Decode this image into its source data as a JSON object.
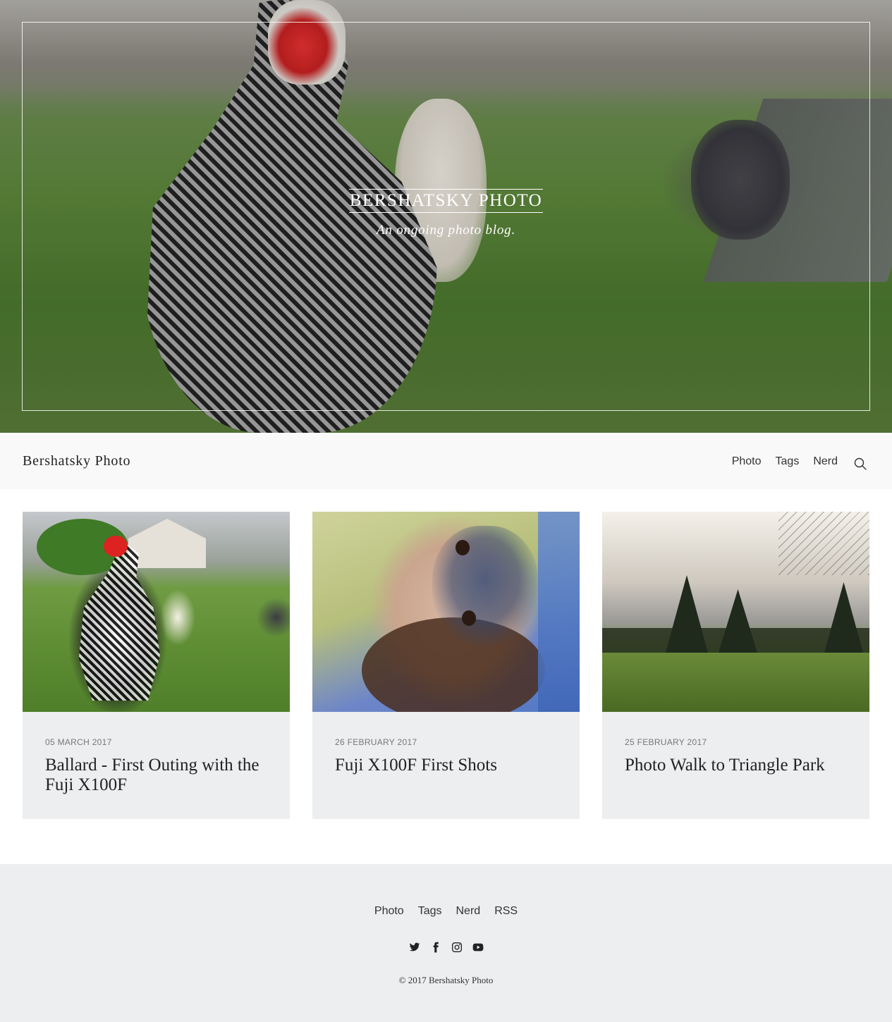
{
  "hero": {
    "title": "BERSHATSKY PHOTO",
    "subtitle": "An ongoing photo blog."
  },
  "nav": {
    "brand": "Bershatsky Photo",
    "links": [
      "Photo",
      "Tags",
      "Nerd"
    ],
    "search_icon": "search-icon"
  },
  "posts": [
    {
      "date": "05 MARCH 2017",
      "title": "Ballard - First Outing with the Fuji X100F"
    },
    {
      "date": "26 FEBRUARY 2017",
      "title": "Fuji X100F First Shots"
    },
    {
      "date": "25 FEBRUARY 2017",
      "title": "Photo Walk to Triangle Park"
    }
  ],
  "footer": {
    "links": [
      "Photo",
      "Tags",
      "Nerd",
      "RSS"
    ],
    "social_icons": [
      "twitter-icon",
      "facebook-icon",
      "instagram-icon",
      "youtube-icon"
    ],
    "copyright": "© 2017 Bershatsky Photo"
  },
  "colors": {
    "nav_bg": "#f9f9f9",
    "card_bg": "#eceeef",
    "footer_bg": "#eceeef",
    "text": "#222222",
    "meta": "#777777"
  }
}
